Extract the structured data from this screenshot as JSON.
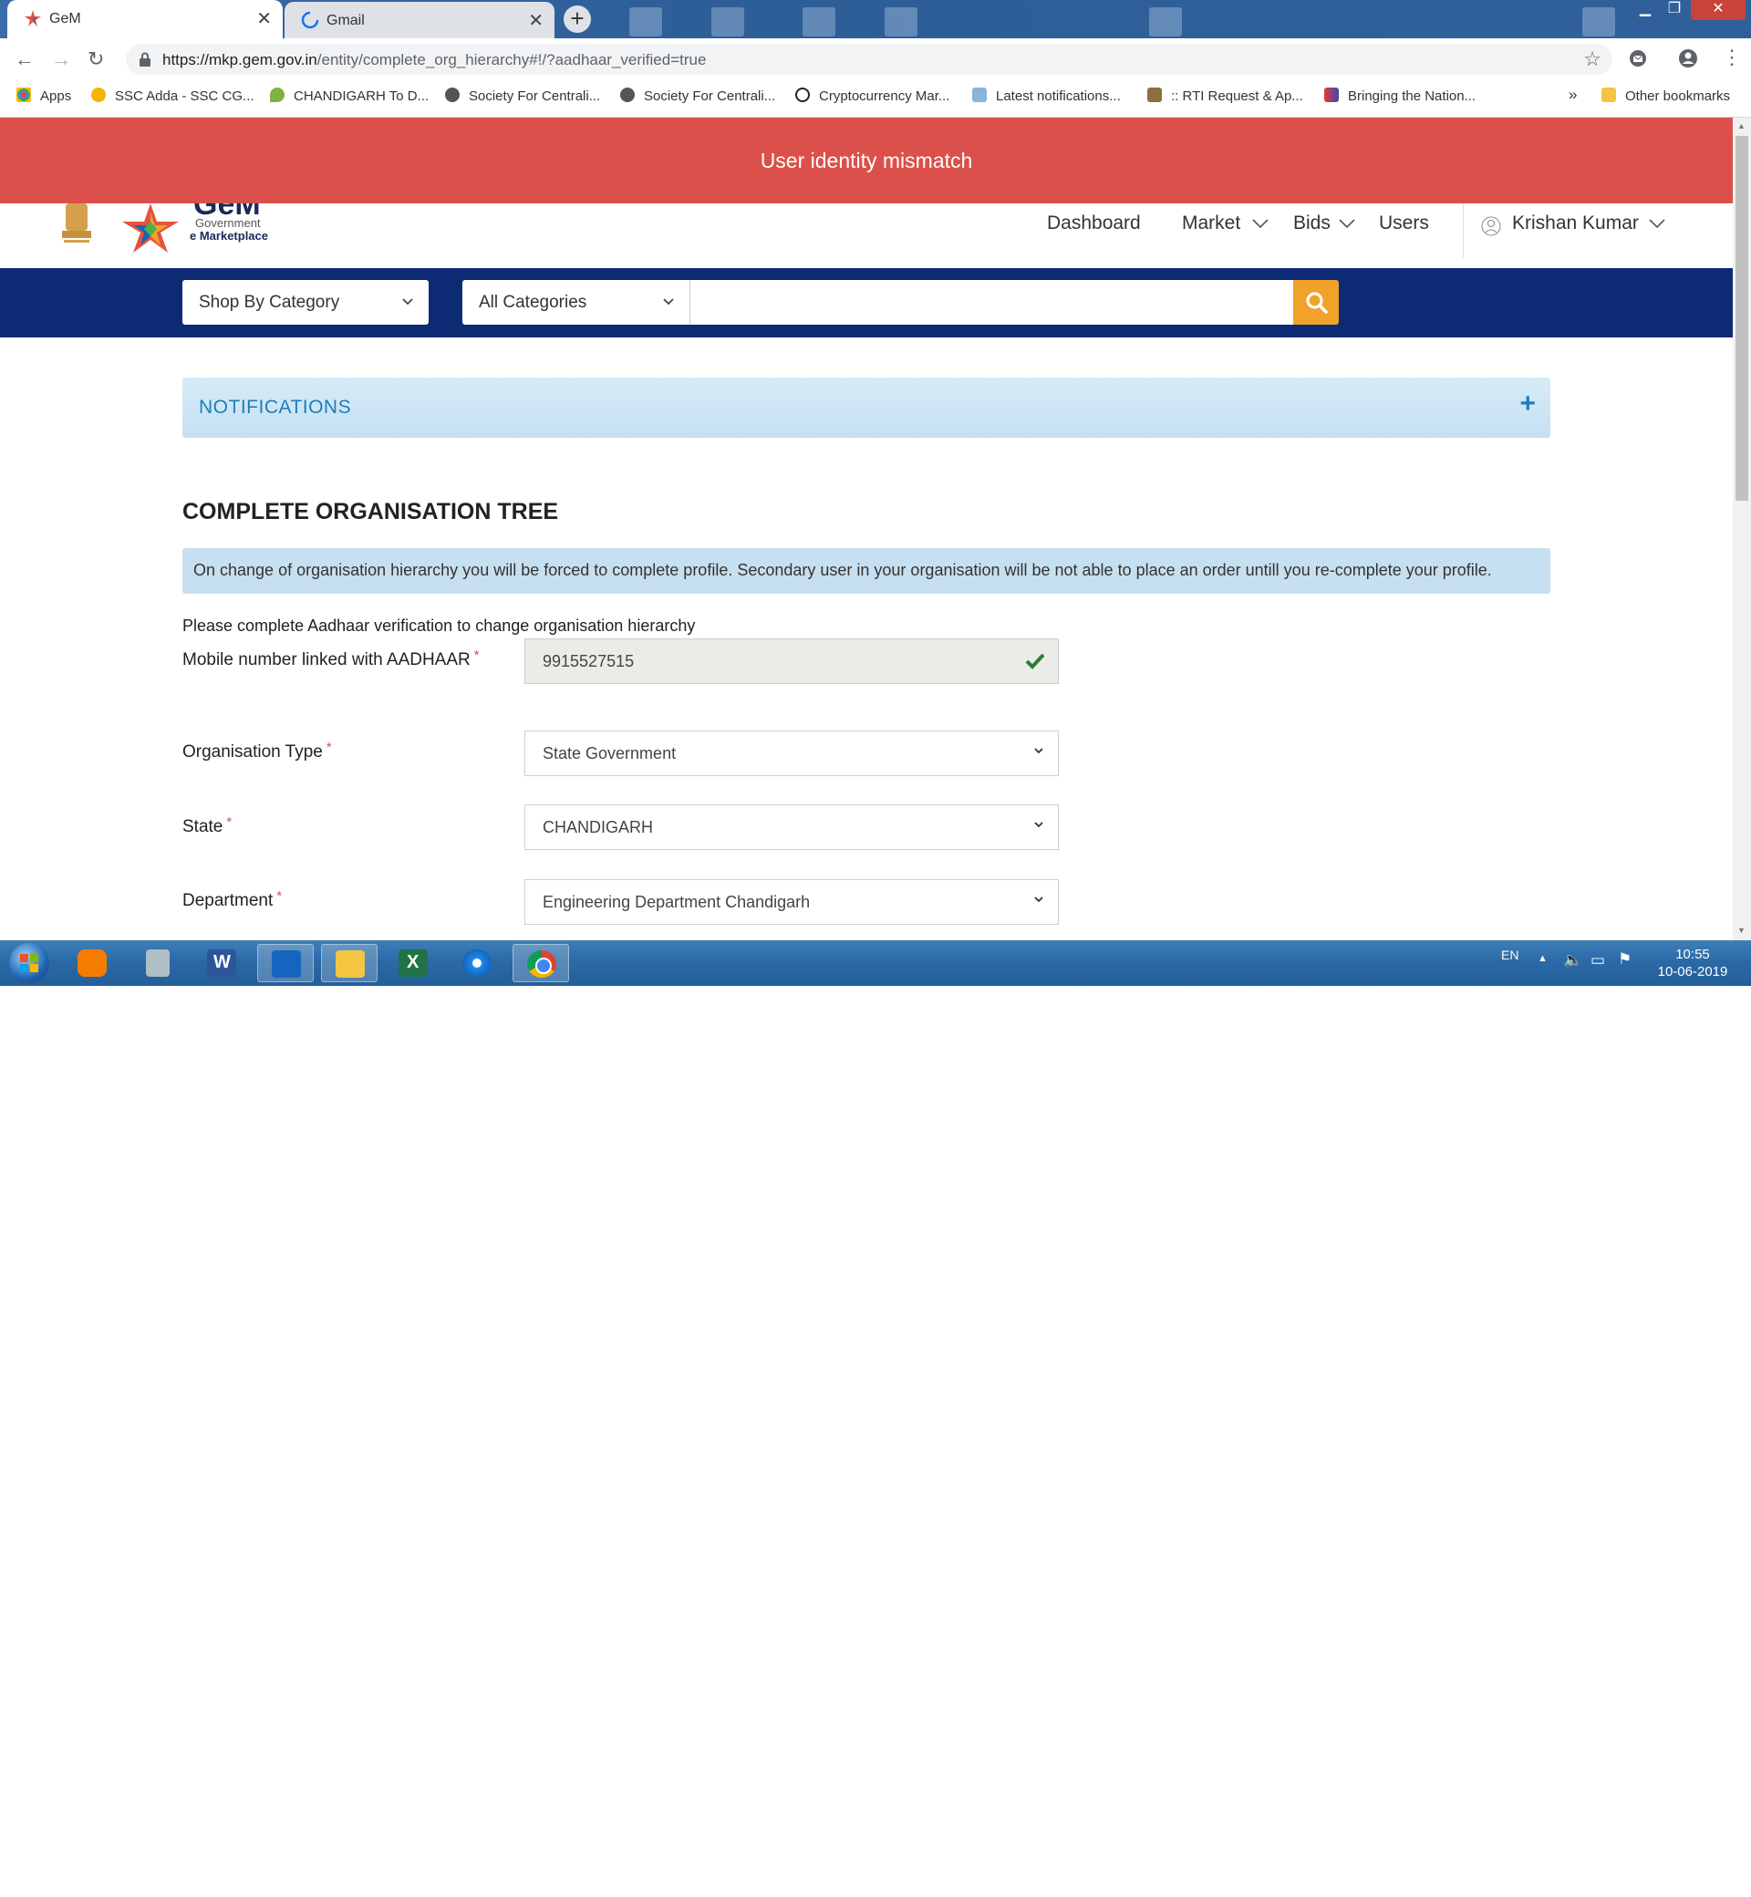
{
  "browser": {
    "tabs": [
      {
        "title": "GeM",
        "active": true
      },
      {
        "title": "Gmail",
        "active": false
      }
    ],
    "url_host": "https://mkp.gem.gov.in",
    "url_path": "/entity/complete_org_hierarchy#!/?aadhaar_verified=true",
    "bookmarks": [
      "Apps",
      "SSC Adda - SSC CG...",
      "CHANDIGARH To D...",
      "Society For Centrali...",
      "Society For Centrali...",
      "Cryptocurrency Mar...",
      "Latest notifications...",
      ":: RTI Request & Ap...",
      "Bringing the Nation..."
    ],
    "bookmarks_overflow": "»",
    "other_bookmarks": "Other bookmarks"
  },
  "alert": {
    "text": "User identity mismatch",
    "color": "#db504a"
  },
  "header": {
    "logo_line1": "GeM",
    "logo_line2": "Government",
    "logo_line3": "e Marketplace",
    "nav": [
      "Dashboard",
      "Market",
      "Bids",
      "Users"
    ],
    "user_name": "Krishan Kumar"
  },
  "category_bar": {
    "shop_by": "Shop By Category",
    "all_categories": "All Categories",
    "search_value": "",
    "color": "#0c2b74",
    "search_button_color": "#f0a22b"
  },
  "notifications": {
    "title": "NOTIFICATIONS",
    "toggle": "+"
  },
  "main": {
    "title": "COMPLETE ORGANISATION TREE",
    "info": "On change of organisation hierarchy you will be forced to complete profile. Secondary user in your organisation will be not able to place an order untill you re-complete your profile.",
    "aadhaar_note": "Please complete Aadhaar verification to change organisation hierarchy",
    "fields": [
      {
        "label": "Mobile number linked with AADHAAR",
        "value": "9915527515",
        "required": true,
        "verified": true
      },
      {
        "label": "Organisation Type",
        "value": "State Government",
        "required": true
      },
      {
        "label": "State",
        "value": "CHANDIGARH",
        "required": true
      },
      {
        "label": "Department",
        "value": "Engineering Department Chandigarh",
        "required": true
      }
    ]
  },
  "taskbar": {
    "language": "EN",
    "time": "10:55",
    "date": "10-06-2019",
    "apps": [
      "start-orb",
      "media-player",
      "calculator",
      "word",
      "mcafee",
      "file-explorer",
      "excel",
      "internet-explorer",
      "chrome"
    ]
  }
}
